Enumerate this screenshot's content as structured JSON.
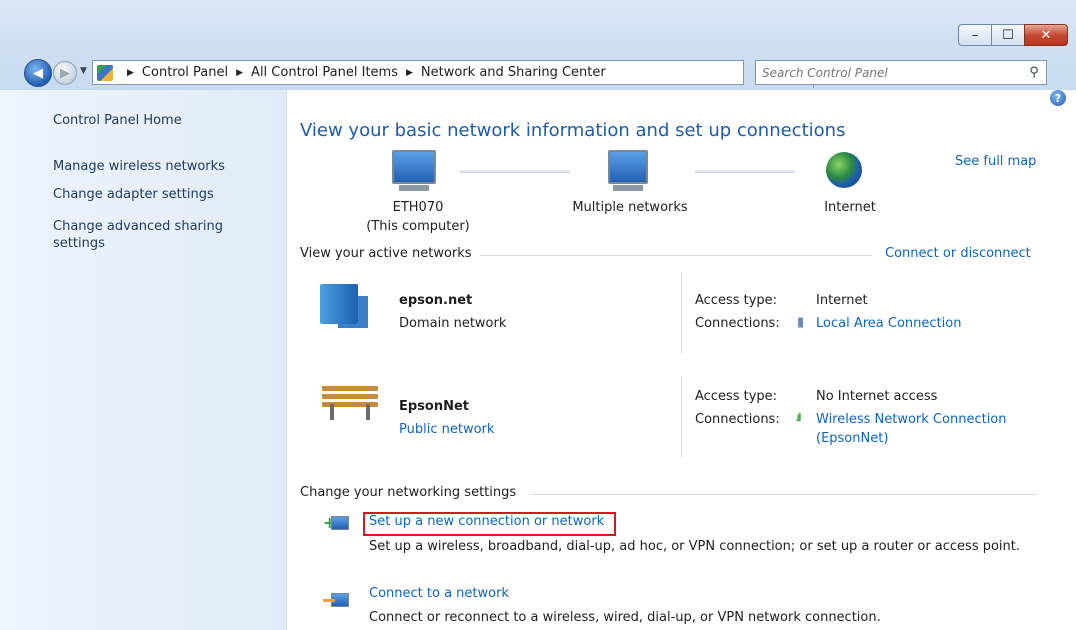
{
  "window": {
    "address": {
      "crumbs": [
        "Control Panel",
        "All Control Panel Items",
        "Network and Sharing Center"
      ]
    },
    "search": {
      "placeholder": "Search Control Panel"
    },
    "buttons": {
      "minimize": "–",
      "maximize": "☐",
      "close": "✕"
    }
  },
  "sidebar": {
    "home": "Control Panel Home",
    "items": [
      "Manage wireless networks",
      "Change adapter settings",
      "Change advanced sharing settings"
    ]
  },
  "main": {
    "title": "View your basic network information and set up connections",
    "see_full_map": "See full map",
    "map": {
      "computer_name": "ETH070",
      "computer_sub": "(This computer)",
      "middle": "Multiple networks",
      "internet": "Internet"
    },
    "active_networks": {
      "heading": "View your active networks",
      "connect_link": "Connect or disconnect",
      "networks": [
        {
          "name": "epson.net",
          "type": "Domain network",
          "access_label": "Access type:",
          "access": "Internet",
          "conn_label": "Connections:",
          "connection": "Local Area Connection"
        },
        {
          "name": "EpsonNet",
          "type": "Public network",
          "access_label": "Access type:",
          "access": "No Internet access",
          "conn_label": "Connections:",
          "connection_line1": "Wireless Network Connection",
          "connection_line2": "(EpsonNet)"
        }
      ]
    },
    "settings": {
      "heading": "Change your networking settings",
      "items": [
        {
          "link": "Set up a new connection or network",
          "desc": "Set up a wireless, broadband, dial-up, ad hoc, or VPN connection; or set up a router or access point."
        },
        {
          "link": "Connect to a network",
          "desc": "Connect or reconnect to a wireless, wired, dial-up, or VPN network connection."
        }
      ]
    }
  },
  "colors": {
    "link": "#0b64c4",
    "title": "#1e5ba8",
    "highlight": "#e0141b"
  }
}
